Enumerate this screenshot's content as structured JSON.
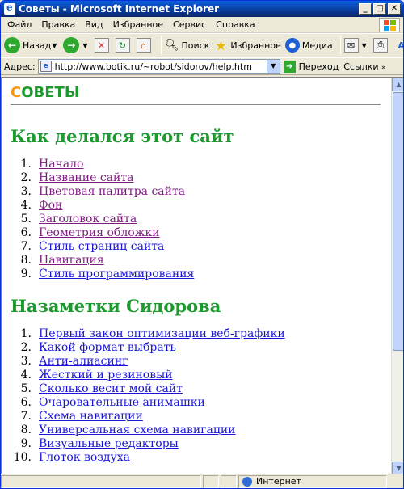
{
  "window": {
    "title": "Советы - Microsoft Internet Explorer"
  },
  "menu": [
    "Файл",
    "Правка",
    "Вид",
    "Избранное",
    "Сервис",
    "Справка"
  ],
  "toolbar": {
    "back_label": "Назад",
    "search_label": "Поиск",
    "favorites_label": "Избранное",
    "media_label": "Медиа"
  },
  "address": {
    "label": "Адрес:",
    "url": "http://www.botik.ru/~robot/sidorov/help.htm",
    "go_label": "Переход",
    "links_label": "Ссылки"
  },
  "page": {
    "logo_first": "С",
    "logo_rest": "ОВЕТЫ",
    "section1_title": "Как делался этот сайт",
    "section1_items": [
      {
        "num": "1.",
        "text": "Начало",
        "visited": true
      },
      {
        "num": "2.",
        "text": "Название сайта",
        "visited": true
      },
      {
        "num": "3.",
        "text": "Цветовая палитра сайта",
        "visited": true
      },
      {
        "num": "4.",
        "text": "Фон",
        "visited": true
      },
      {
        "num": "5.",
        "text": "Заголовок сайта",
        "visited": true
      },
      {
        "num": "6.",
        "text": "Геометрия обложки",
        "visited": true
      },
      {
        "num": "7.",
        "text": "Стиль страниц сайта",
        "visited": false
      },
      {
        "num": "8.",
        "text": "Навигация",
        "visited": true
      },
      {
        "num": "9.",
        "text": "Стиль программирования",
        "visited": false
      }
    ],
    "section2_title": "Назаметки Сидорова",
    "section2_items": [
      {
        "num": "1.",
        "text": "Первый закон оптимизации веб-графики"
      },
      {
        "num": "2.",
        "text": "Какой формат выбрать"
      },
      {
        "num": "3.",
        "text": "Анти-алиасинг"
      },
      {
        "num": "4.",
        "text": "Жесткий и резиновый"
      },
      {
        "num": "5.",
        "text": "Сколько весит мой сайт"
      },
      {
        "num": "6.",
        "text": "Очаровательные анимашки"
      },
      {
        "num": "7.",
        "text": "Схема навигации"
      },
      {
        "num": "8.",
        "text": "Универсальная схема навигации"
      },
      {
        "num": "9.",
        "text": "Визуальные редакторы"
      },
      {
        "num": "10.",
        "text": "Глоток воздуха"
      }
    ]
  },
  "status": {
    "zone": "Интернет"
  },
  "colors": {
    "heading": "#1c9a2e",
    "link": "#1a16d8",
    "visited": "#7d1b7e",
    "logo_accent": "#f39a14"
  }
}
